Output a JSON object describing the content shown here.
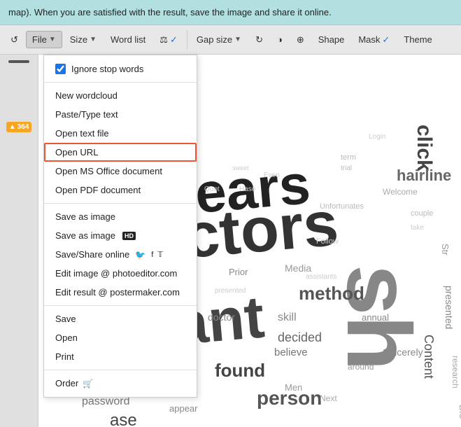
{
  "infobar": {
    "text": "map). When you are satisfied with the result, save the image and share it online."
  },
  "toolbar": {
    "refresh_label": "↺",
    "file_label": "File",
    "size_label": "Size",
    "wordlist_label": "Word list",
    "balance_label": "⚖ ✓",
    "gapsize_label": "Gap size",
    "rotate_label": "↻",
    "contrast_label": "◑",
    "target_label": "⊕",
    "shape_label": "Shape",
    "mask_label": "Mask ✓",
    "theme_label": "Theme"
  },
  "dropdown": {
    "ignore_stop_words_label": "Ignore stop words",
    "ignore_stop_words_checked": true,
    "new_wordcloud_label": "New wordcloud",
    "paste_type_text_label": "Paste/Type text",
    "open_text_file_label": "Open text file",
    "open_url_label": "Open URL",
    "open_ms_office_label": "Open MS Office document",
    "open_pdf_label": "Open PDF document",
    "save_as_image_label": "Save as image",
    "save_as_image_hd_label": "Save as image",
    "save_share_online_label": "Save/Share online",
    "edit_image_photo_label": "Edit image @ photoeditor.com",
    "edit_result_poster_label": "Edit result @ postermaker.com",
    "save_label": "Save",
    "open_label": "Open",
    "print_label": "Print",
    "order_label": "Order",
    "hd_badge": "HD"
  },
  "left_panel": {
    "warning_text": "▲ 364"
  },
  "colors": {
    "accent": "#b2e0e0",
    "highlight_border": "#e05530",
    "warning_bg": "#f5a623"
  }
}
